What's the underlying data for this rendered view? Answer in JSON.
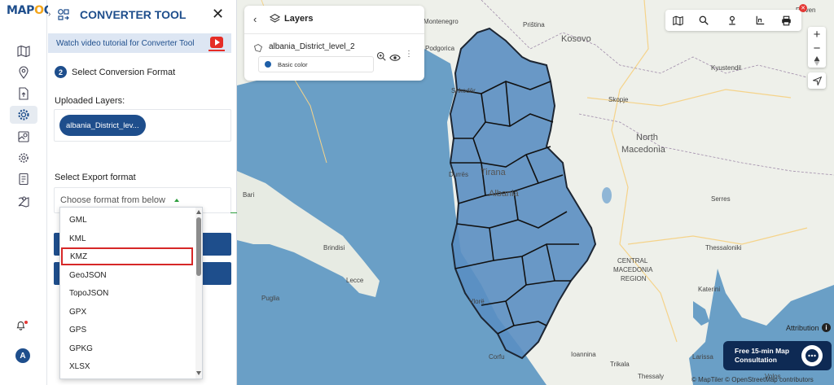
{
  "app": {
    "logo_text_a": "MAP",
    "logo_text_o": "O",
    "logo_text_b": "G"
  },
  "panel": {
    "title": "CONVERTER TOOL",
    "tutorial_text": "Watch video tutorial for Converter Tool",
    "step_number": "2",
    "step_label": "Select Conversion Format",
    "uploaded_label": "Uploaded Layers:",
    "uploaded_layer": "albania_District_lev...",
    "export_label": "Select Export format",
    "format_placeholder": "Choose format from below"
  },
  "dropdown": {
    "options": [
      "GML",
      "KML",
      "KMZ",
      "GeoJSON",
      "TopoJSON",
      "GPX",
      "GPS",
      "GPKG",
      "XLSX"
    ],
    "highlighted": "KMZ",
    "highlight_color": "#d62828"
  },
  "layers": {
    "title": "Layers",
    "layer_name": "albania_District_level_2",
    "style_label": "Basic color",
    "style_color": "#1e5fa8"
  },
  "map": {
    "labels": {
      "montenegro": "Montenegro",
      "kosovo": "Kosovo",
      "podgorica": "Podgorica",
      "pristina": "Priština",
      "shkoder": "Shkodër",
      "kyustendil": "Kyustendil",
      "skopje": "Skopje",
      "north_macedonia_1": "North",
      "north_macedonia_2": "Macedonia",
      "durres": "Durrës",
      "tirana": "Tirana",
      "albania": "Albania",
      "bari": "Bari",
      "serres": "Serres",
      "brindisi": "Brindisi",
      "thessaloniki": "Thessaloniki",
      "lecce": "Lecce",
      "central_macedonia_1": "CENTRAL",
      "central_macedonia_2": "MACEDONIA",
      "central_macedonia_3": "REGION",
      "katerini": "Katerini",
      "puglia": "Puglia",
      "larissa": "Larissa",
      "corfu": "Corfu",
      "ioannina": "Ioannina",
      "volos": "Volos",
      "thessaly": "Thessaly",
      "trikala": "Trikala",
      "pleven": "Pleven",
      "vlore": "Vlorë"
    },
    "attribution": "Attribution",
    "consult_text": "Free 15-min Map Consultation",
    "copyright": "© MapTiler © OpenStreetMap contributors",
    "avatar_letter": "A"
  }
}
